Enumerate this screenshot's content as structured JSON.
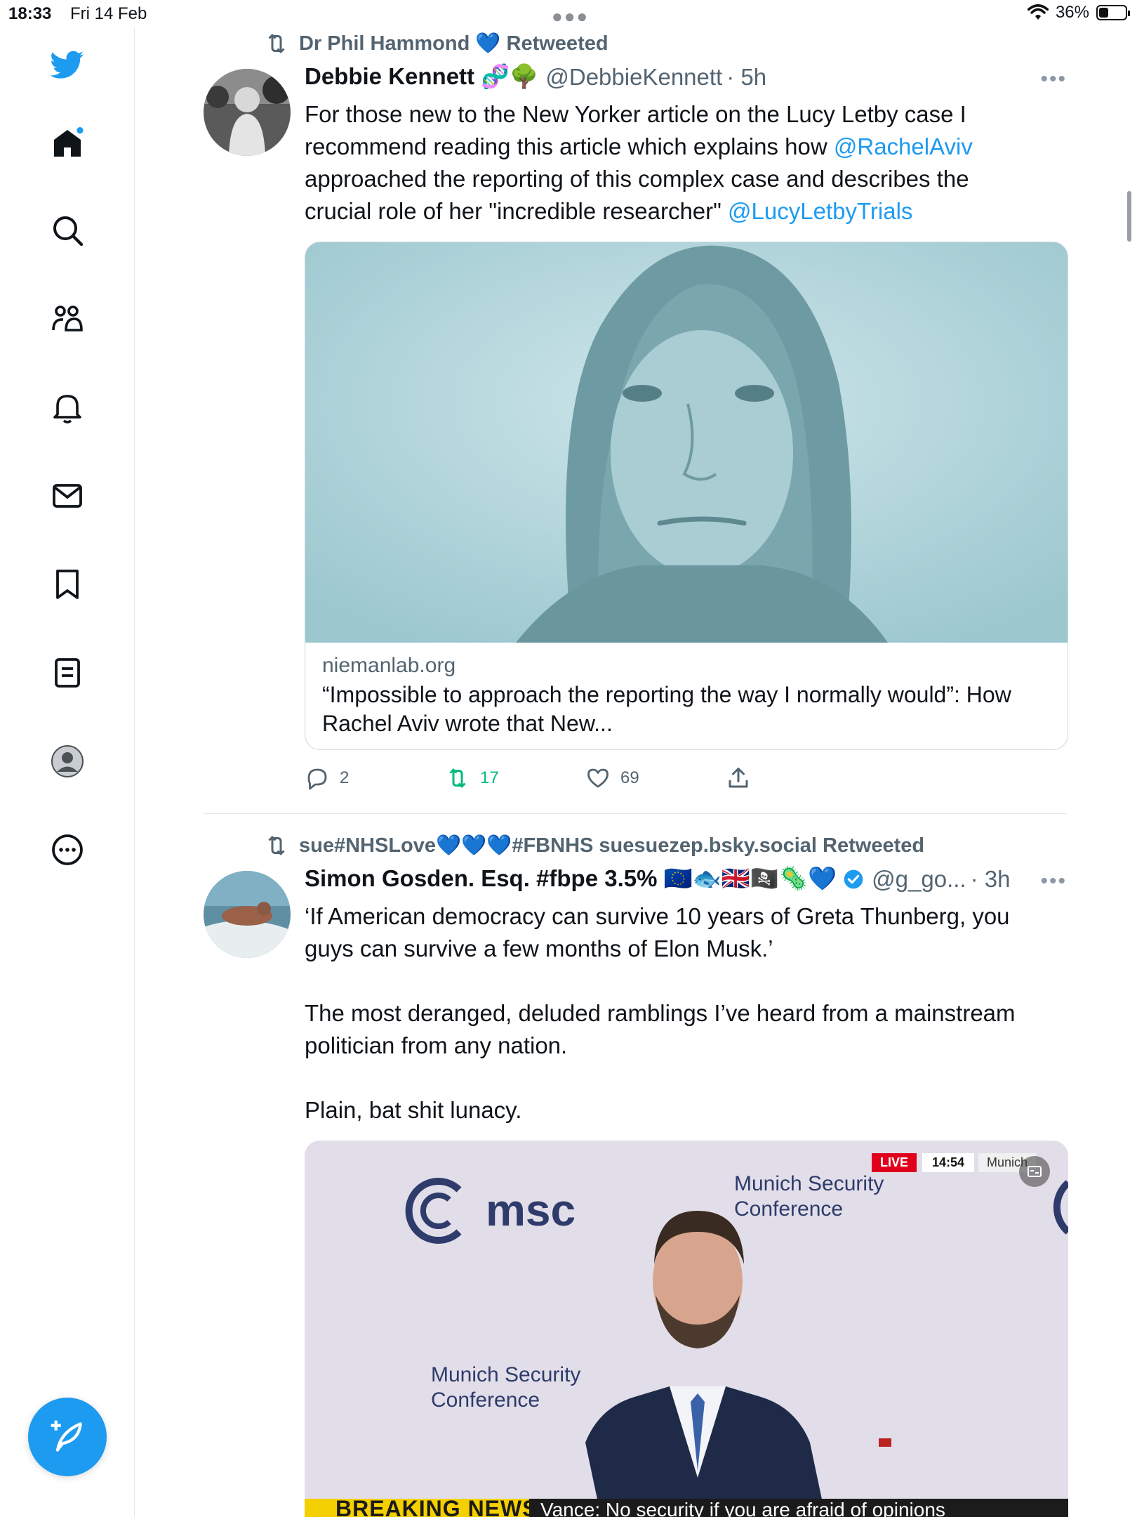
{
  "status_bar": {
    "time": "18:33",
    "date": "Fri 14 Feb",
    "battery": "36%",
    "battery_level": 0.36
  },
  "sidebar": {
    "icons": [
      "twitter-logo",
      "home-icon",
      "search-icon",
      "communities-icon",
      "notifications-icon",
      "messages-icon",
      "bookmarks-icon",
      "lists-icon",
      "profile-icon",
      "more-icon"
    ],
    "compose_icon": "compose-icon"
  },
  "tweets": [
    {
      "retweeted_by": "Dr Phil Hammond 💙 Retweeted",
      "author_name": "Debbie Kennett 🧬🌳",
      "author_handle": "@DebbieKennett",
      "time": "· 5h",
      "text_line1": "For those new to the New Yorker article on the Lucy Letby case I",
      "text_line2_pre": "recommend reading this article which explains how ",
      "mention1": "@RachelAviv",
      "text_line3": "approached the reporting of this complex case and describes the",
      "text_line4_pre": "crucial role of her \"incredible researcher\" ",
      "mention2": "@LucyLetbyTrials",
      "card": {
        "domain": "niemanlab.org",
        "title": "“Impossible to approach the reporting the way I normally would”: How Rachel Aviv wrote that New..."
      },
      "replies": "2",
      "retweets": "17",
      "likes": "69"
    },
    {
      "retweeted_by": "sue#NHSLove💙💙💙#FBNHS suesuezep.bsky.social Retweeted",
      "author_name": "Simon Gosden. Esq. #fbpe 3.5% 🇪🇺🐟🇬🇧🏴‍☠️🦠💙",
      "author_handle": "@g_go...",
      "time": "· 3h",
      "paragraph1": "‘If American democracy can survive 10 years of Greta Thunberg, you guys can survive a few months of Elon Musk.’",
      "paragraph2": "The most deranged, deluded ramblings I’ve heard from a mainstream politician from any nation.",
      "paragraph3": "Plain, bat shit lunacy.",
      "media": {
        "logo": "msc",
        "backdrop_text_top": "Munich Security Conference",
        "backdrop_text_left": "Munich Security Conference",
        "live_badge": "LIVE",
        "clock": "14:54",
        "location": "Munich",
        "ticker_label": "BREAKING NEWS",
        "ticker_text": "Vance: No security if you are afraid of opinions"
      }
    }
  ]
}
